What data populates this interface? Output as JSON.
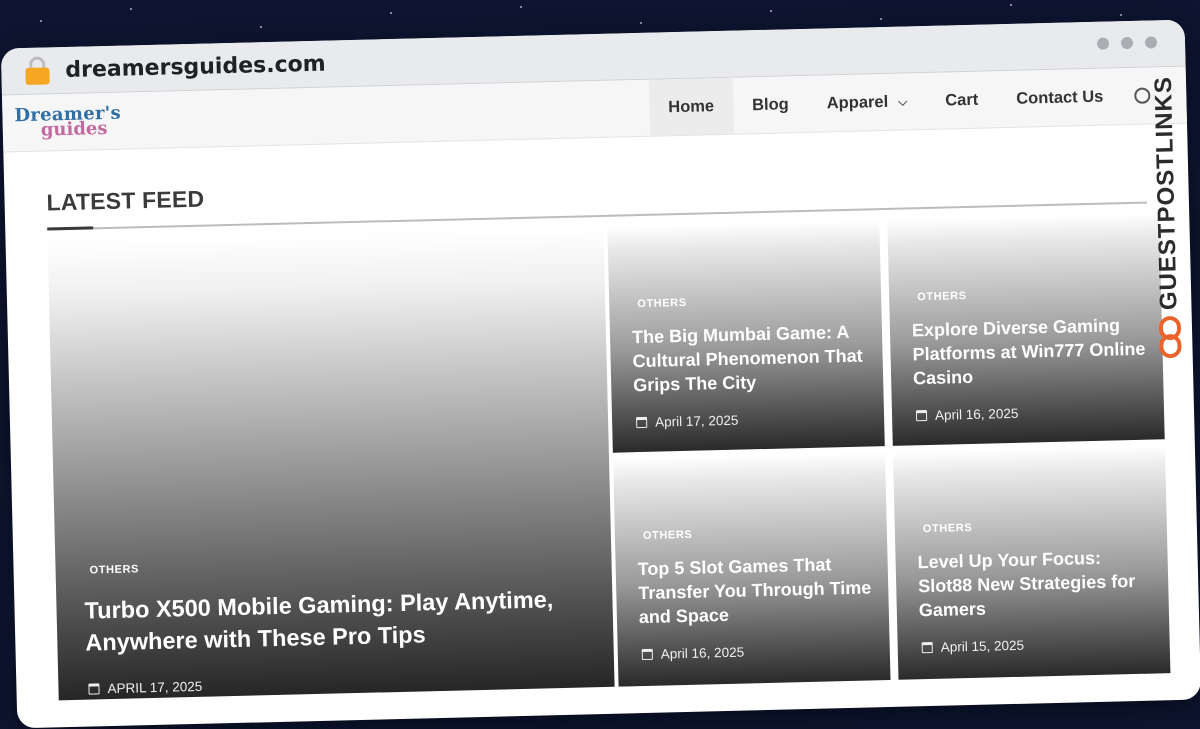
{
  "browser": {
    "url": "dreamersguides.com"
  },
  "site": {
    "logo_line1": "Dreamer's",
    "logo_line2": "guides",
    "nav": [
      {
        "label": "Home"
      },
      {
        "label": "Blog"
      },
      {
        "label": "Apparel"
      },
      {
        "label": "Cart"
      },
      {
        "label": "Contact Us"
      }
    ]
  },
  "feed": {
    "section_title": "LATEST FEED",
    "featured": {
      "category": "OTHERS",
      "title": "Turbo X500 Mobile Gaming: Play Anytime, Anywhere with These Pro Tips",
      "date": "APRIL 17, 2025"
    },
    "posts": [
      {
        "category": "OTHERS",
        "title": "The Big Mumbai Game: A Cultural Phenomenon That Grips The City",
        "date": "April 17, 2025"
      },
      {
        "category": "OTHERS",
        "title": "Explore Diverse Gaming Platforms at Win777 Online Casino",
        "date": "April 16, 2025"
      },
      {
        "category": "OTHERS",
        "title": "Top 5 Slot Games That Transfer You Through Time and Space",
        "date": "April 16, 2025"
      },
      {
        "category": "OTHERS",
        "title": "Level Up Your Focus: Slot88 New Strategies for Gamers",
        "date": "April 15, 2025"
      }
    ]
  },
  "watermark": {
    "text": "GUESTPOSTLINKS"
  },
  "colors": {
    "background": "#0d1530",
    "lock": "#f5a623",
    "badge_accent": "#e8642c"
  },
  "icons": [
    "lock-icon",
    "chevron-down-icon",
    "search-icon",
    "calendar-icon",
    "link-icon"
  ]
}
